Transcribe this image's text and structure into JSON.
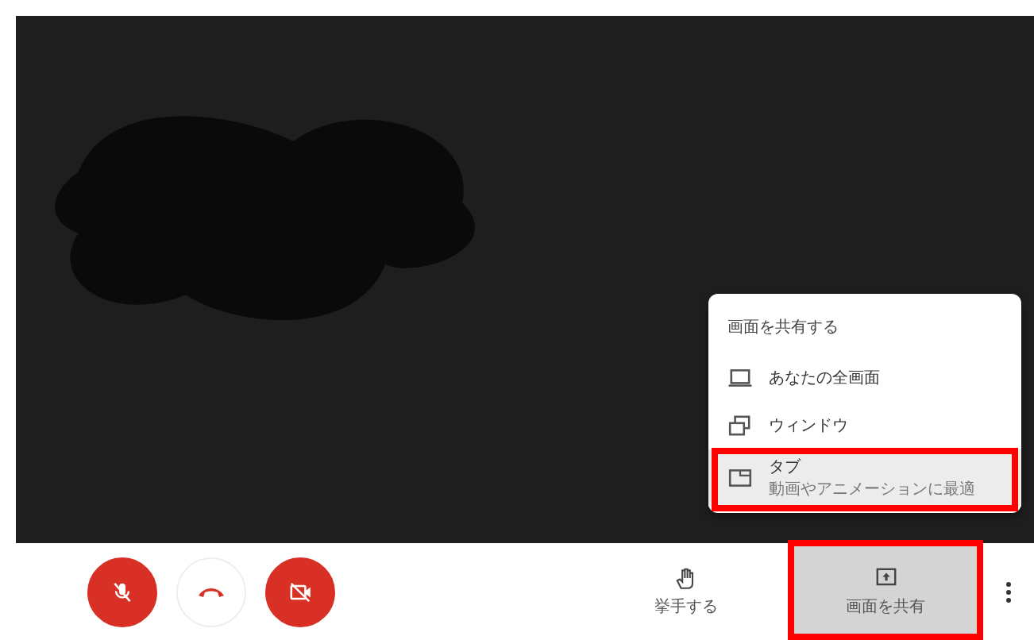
{
  "share_menu": {
    "title": "画面を共有する",
    "items": [
      {
        "kind": "screen",
        "label": "あなたの全画面",
        "selected": false
      },
      {
        "kind": "window",
        "label": "ウィンドウ",
        "selected": false
      },
      {
        "kind": "tab",
        "label": "タブ",
        "subtitle": "動画やアニメーションに最適",
        "selected": true
      }
    ]
  },
  "controls": [
    {
      "kind": "mic",
      "muted": true
    },
    {
      "kind": "hangup"
    },
    {
      "kind": "camera",
      "muted": true
    }
  ],
  "actions": [
    {
      "kind": "hand",
      "label": "挙手する",
      "selected": false
    },
    {
      "kind": "present",
      "label": "画面を共有",
      "selected": true
    }
  ]
}
